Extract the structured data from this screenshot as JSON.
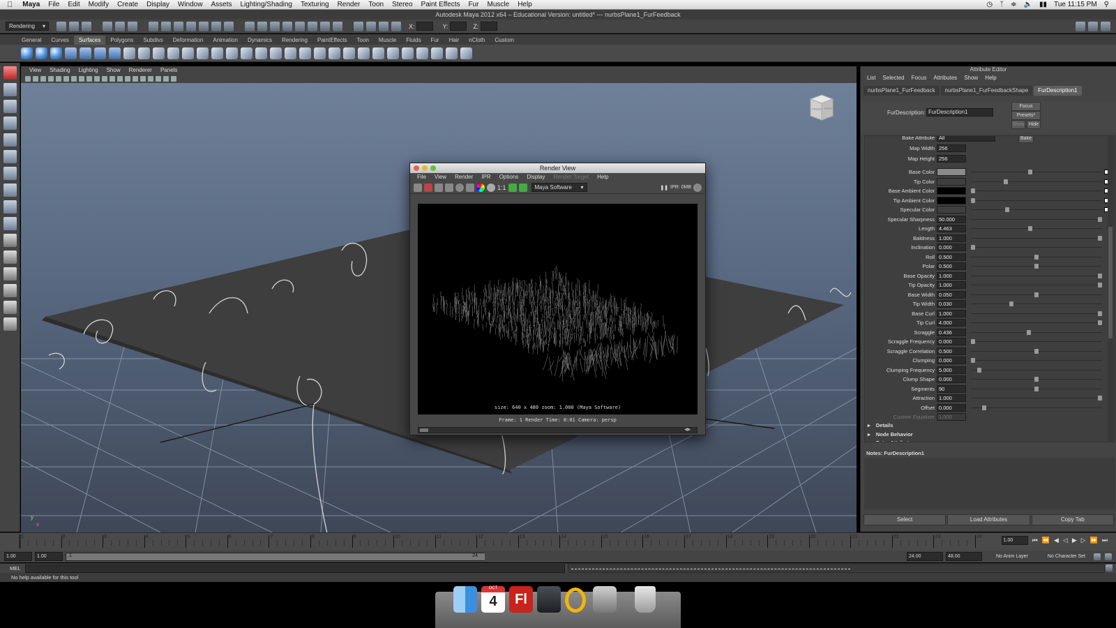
{
  "mac_menubar": {
    "apple": "",
    "app": "Maya",
    "items": [
      "File",
      "Edit",
      "Modify",
      "Create",
      "Display",
      "Window",
      "Assets",
      "Lighting/Shading",
      "Texturing",
      "Render",
      "Toon",
      "Stereo",
      "Paint Effects",
      "Fur",
      "Muscle",
      "Help"
    ],
    "clock": "Tue 11:15 PM"
  },
  "window_title": "Autodesk Maya 2012 x64 – Educational Version: untitled*   ---   nurbsPlane1_FurFeedback",
  "status_line": {
    "menu_set": "Rendering",
    "x_label": "X:",
    "y_label": "Y:",
    "z_label": "Z:"
  },
  "shelf_tabs": [
    "General",
    "Curves",
    "Surfaces",
    "Polygons",
    "Subdivs",
    "Deformation",
    "Animation",
    "Dynamics",
    "Rendering",
    "PaintEffects",
    "Toon",
    "Muscle",
    "Fluids",
    "Fur",
    "Hair",
    "nCloth",
    "Custom"
  ],
  "shelf_active": "Surfaces",
  "panel_menu": [
    "View",
    "Shading",
    "Lighting",
    "Show",
    "Renderer",
    "Panels"
  ],
  "viewcube": {
    "front": "FRONT",
    "right": "RIGHT"
  },
  "axis": {
    "x": "x",
    "y": "y"
  },
  "render_view": {
    "title": "Render View",
    "menu": [
      "File",
      "View",
      "Render",
      "IPR",
      "Options",
      "Display",
      "Render Target",
      "Help"
    ],
    "renderer": "Maya Software",
    "ratio_label": "1:1",
    "ipr_label": "IPR: 0MB",
    "info_line1": "size: 640 x 480 zoom: 1.000      (Maya Software)",
    "info_line2": "Frame: 1      Render Time: 0:01      Camera: persp"
  },
  "attribute_editor": {
    "title": "Attribute Editor",
    "menu": [
      "List",
      "Selected",
      "Focus",
      "Attributes",
      "Show",
      "Help"
    ],
    "tabs": [
      "nurbsPlane1_FurFeedback",
      "nurbsPlane1_FurFeedbackShape",
      "FurDescription1"
    ],
    "active_tab": "FurDescription1",
    "node_label": "FurDescription:",
    "node_value": "FurDescription1",
    "focus_button": "Focus",
    "presets_button": "Presets*",
    "show_button": "Show",
    "hide_button": "Hide",
    "bake_attr_label": "Bake Attribute",
    "bake_attr_value": "All",
    "bake_button": "Bake",
    "attributes": [
      {
        "label": "Map Width",
        "value": "256"
      },
      {
        "label": "Map Height",
        "value": "256"
      },
      {
        "label": "Base Color",
        "value": "",
        "color": "#8a8a8a",
        "level": 0.45
      },
      {
        "label": "Tip Color",
        "value": "",
        "level": 0.26
      },
      {
        "label": "Base Ambient Color",
        "value": "",
        "color": "#000000",
        "level": 0.0
      },
      {
        "label": "Tip Ambient Color",
        "value": "",
        "color": "#000000",
        "level": 0.0
      },
      {
        "label": "Specular Color",
        "value": "",
        "level": 0.27
      },
      {
        "label": "Specular Sharpness",
        "value": "50.000",
        "level": 1.0
      },
      {
        "label": "Length",
        "value": "4.463",
        "level": 0.45
      },
      {
        "label": "Baldness",
        "value": "1.000",
        "level": 1.0
      },
      {
        "label": "Inclination",
        "value": "0.000",
        "level": 0.0
      },
      {
        "label": "Roll",
        "value": "0.500",
        "level": 0.5
      },
      {
        "label": "Polar",
        "value": "0.500",
        "level": 0.5
      },
      {
        "label": "Base Opacity",
        "value": "1.000",
        "level": 1.0
      },
      {
        "label": "Tip Opacity",
        "value": "1.000",
        "level": 1.0
      },
      {
        "label": "Base Width",
        "value": "0.050",
        "level": 0.5
      },
      {
        "label": "Tip Width",
        "value": "0.030",
        "level": 0.3
      },
      {
        "label": "Base Curl",
        "value": "1.000",
        "level": 1.0
      },
      {
        "label": "Tip Curl",
        "value": "4.000",
        "level": 1.0
      },
      {
        "label": "Scraggle",
        "value": "0.436",
        "level": 0.44
      },
      {
        "label": "Scraggle Frequency",
        "value": "0.000",
        "level": 0.0
      },
      {
        "label": "Scraggle Correlation",
        "value": "0.500",
        "level": 0.5
      },
      {
        "label": "Clumping",
        "value": "0.000",
        "level": 0.0
      },
      {
        "label": "Clumping Frequency",
        "value": "5.000",
        "level": 0.05
      },
      {
        "label": "Clump Shape",
        "value": "0.000",
        "level": 0.5
      },
      {
        "label": "Segments",
        "value": "90",
        "level": 0.5
      },
      {
        "label": "Attraction",
        "value": "1.000",
        "level": 1.0
      },
      {
        "label": "Offset",
        "value": "0.000",
        "level": 0.09
      }
    ],
    "custom_equalizer_label": "Custom Equalizer",
    "custom_equalizer_value": "1.000",
    "sections": [
      "Details",
      "Node Behavior",
      "Extra Attributes"
    ],
    "notes_label": "Notes:  FurDescription1",
    "buttons": [
      "Select",
      "Load Attributes",
      "Copy Tab"
    ]
  },
  "time_slider": {
    "ticks": [
      "1",
      "2",
      "3",
      "4",
      "5",
      "6",
      "7",
      "8",
      "9",
      "10",
      "11",
      "12",
      "13",
      "14",
      "15",
      "16",
      "17",
      "18",
      "19",
      "20",
      "21",
      "22",
      "23",
      "24"
    ],
    "current_frame": "1.00"
  },
  "range_slider": {
    "start": "1.00",
    "start_inner": "1.00",
    "range_start": "1",
    "range_end": "24",
    "end_inner": "24.00",
    "end": "48.00",
    "anim_layer": "No Anim Layer",
    "char_set": "No Character Set"
  },
  "command_line": {
    "label": "MEL"
  },
  "help_line": "No help available for this tool",
  "dock": {
    "calendar_month": "OCT",
    "calendar_day": "4",
    "flash_label": "Fl"
  }
}
